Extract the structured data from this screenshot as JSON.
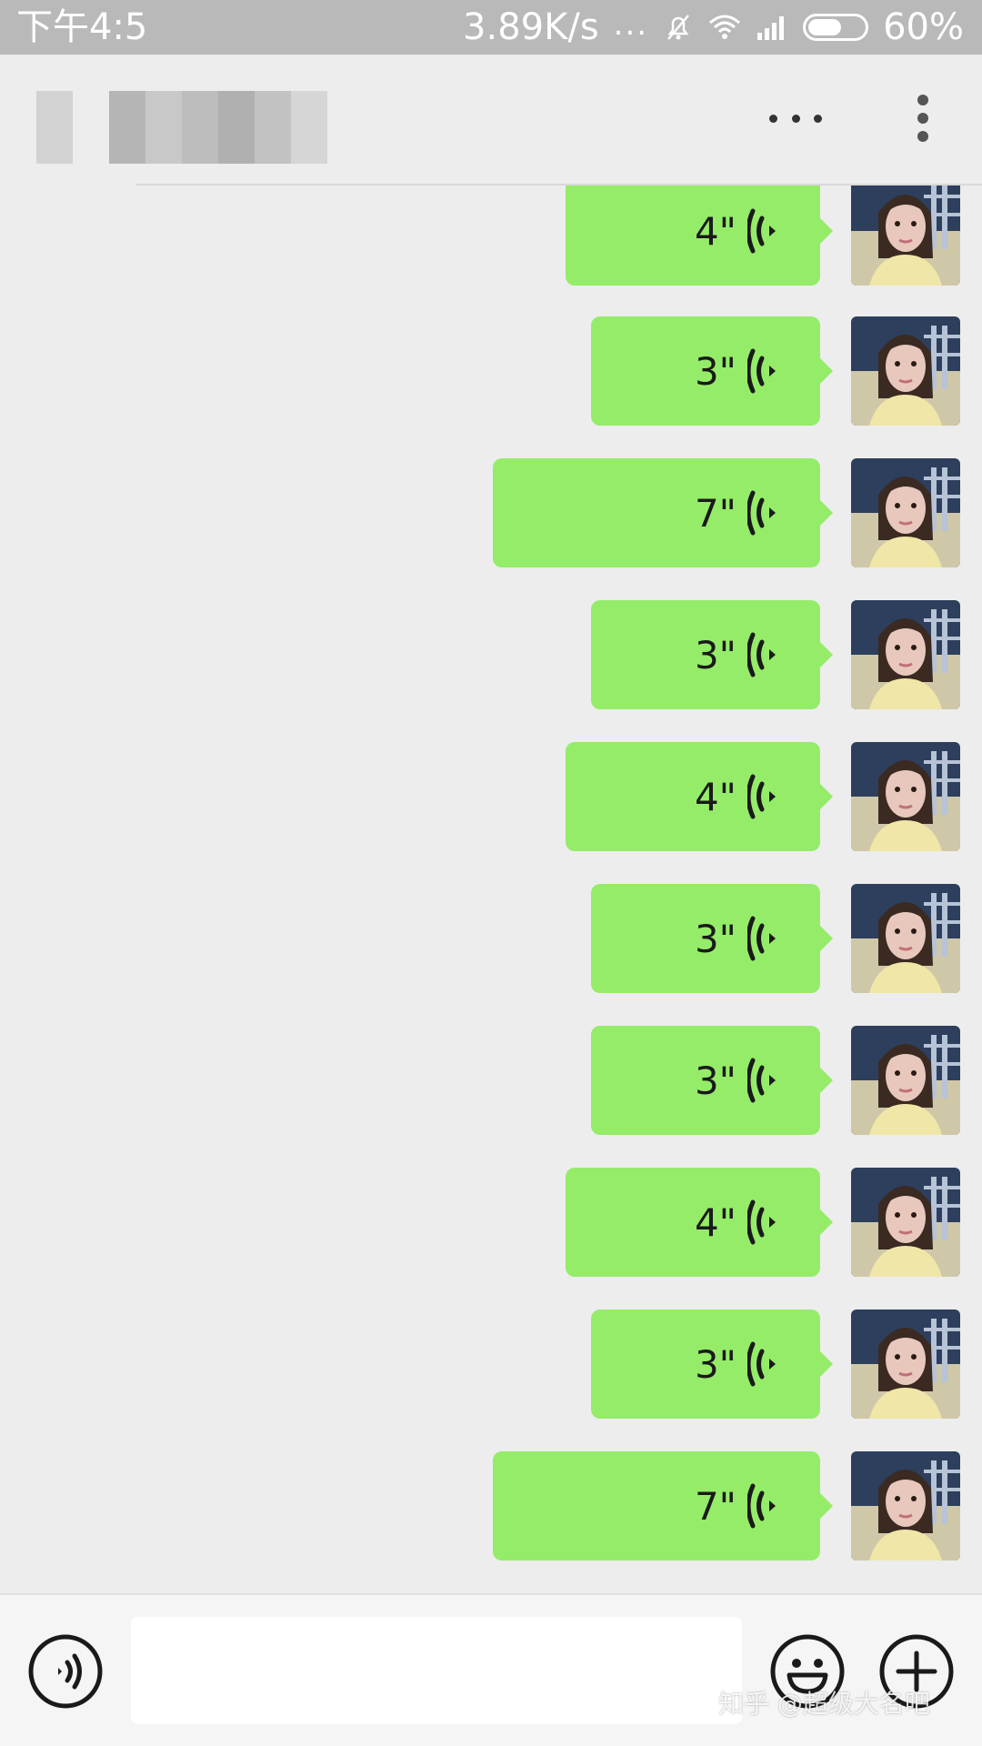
{
  "status_bar": {
    "time": "下午4:5",
    "net_speed": "3.89K/s",
    "more_dots": "...",
    "battery": "60%",
    "battery_level": 0.6
  },
  "header": {
    "title": "",
    "more_icon": "more-horizontal-icon",
    "menu_icon": "more-vertical-icon"
  },
  "messages": [
    {
      "duration": "4\""
    },
    {
      "duration": "3\""
    },
    {
      "duration": "7\""
    },
    {
      "duration": "3\""
    },
    {
      "duration": "4\""
    },
    {
      "duration": "3\""
    },
    {
      "duration": "3\""
    },
    {
      "duration": "4\""
    },
    {
      "duration": "3\""
    },
    {
      "duration": "7\""
    }
  ],
  "input_bar": {
    "voice_icon": "voice-mode-icon",
    "text_value": "",
    "emoji_icon": "emoji-icon",
    "plus_icon": "plus-icon"
  },
  "watermark": "知乎 @超级大名吧",
  "colors": {
    "bubble": "#95ec69",
    "background": "#ededed",
    "status_bar": "#b9b9b9"
  }
}
